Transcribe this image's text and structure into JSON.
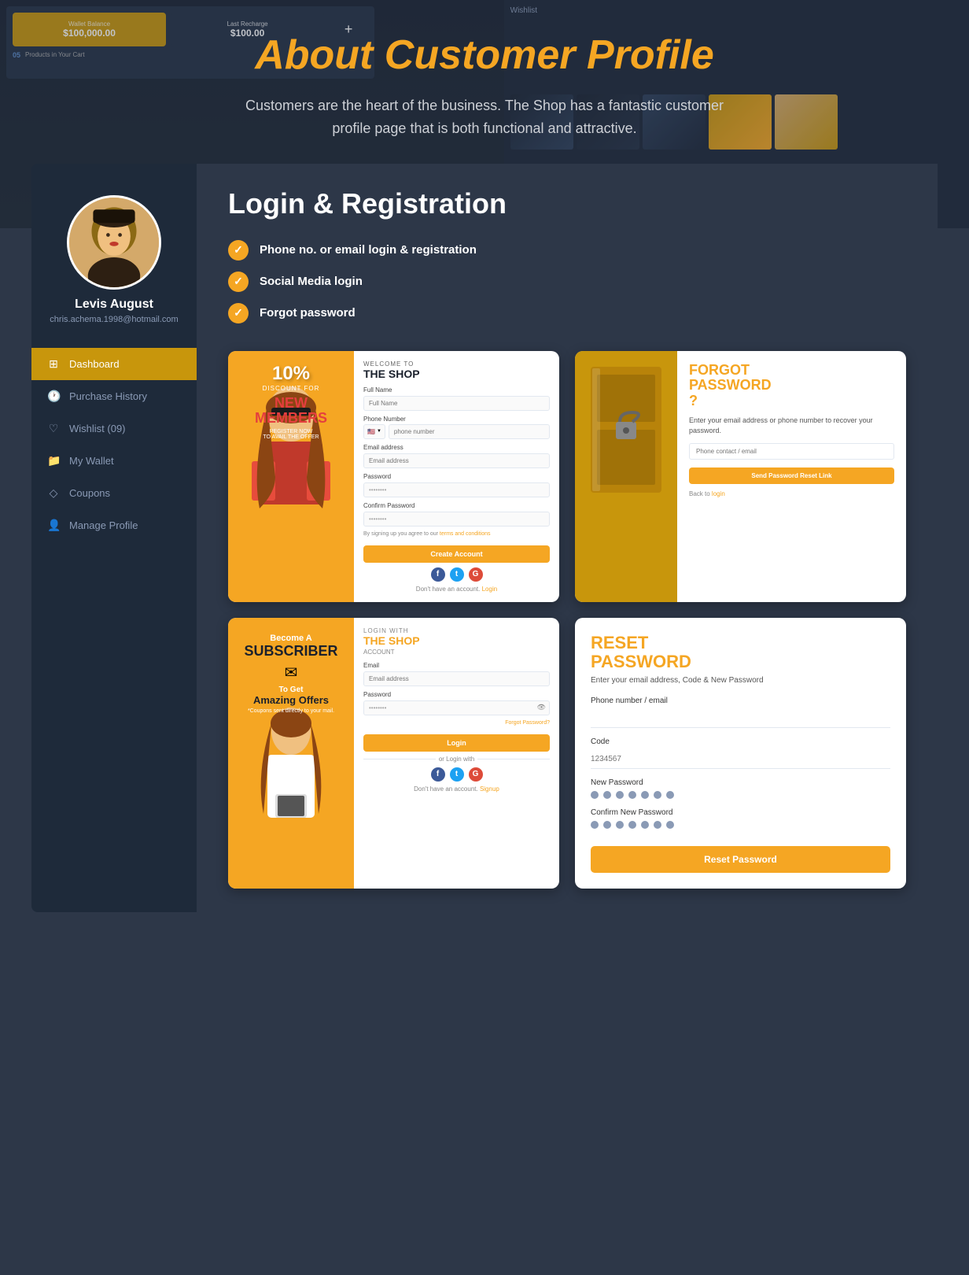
{
  "page": {
    "title": "About Customer Profile"
  },
  "about": {
    "title": "About Customer Profile",
    "description": "Customers are the heart of the business. The Shop has a fantastic customer profile page that is both functional and attractive."
  },
  "login_reg": {
    "heading": "Login & Registration",
    "features": [
      "Phone no. or email login & registration",
      "Social Media login",
      "Forgot password"
    ]
  },
  "sidebar": {
    "user_name": "Levis August",
    "user_email": "chris.achema.1998@hotmail.com",
    "menu_items": [
      {
        "label": "Dashboard",
        "active": true,
        "icon": "grid"
      },
      {
        "label": "Purchase History",
        "active": false,
        "icon": "clock"
      },
      {
        "label": "Wishlist (09)",
        "active": false,
        "icon": "heart"
      },
      {
        "label": "My Wallet",
        "active": false,
        "icon": "folder"
      },
      {
        "label": "Coupons",
        "active": false,
        "icon": "diamond"
      },
      {
        "label": "Manage Profile",
        "active": false,
        "icon": "person"
      }
    ]
  },
  "registration_card": {
    "welcome_label": "WELCOME TO",
    "shop_title": "THE SHOP",
    "discount": "10%",
    "discount_label": "DISCOUNT FOR",
    "new_members": "NEW\nMEMBERS",
    "register_now": "REGISTER NOW TO AVAIL THE OFFER",
    "fields": {
      "full_name_label": "Full Name",
      "full_name_placeholder": "Full Name",
      "phone_label": "Phone Number",
      "phone_placeholder": "phone number",
      "email_label": "Email address",
      "email_placeholder": "Email address",
      "password_label": "Password",
      "confirm_label": "Confirm Password"
    },
    "terms_text": "By signing up you agree to our terms and conditions",
    "create_btn": "Create Account",
    "no_account": "Don't have an account.",
    "login_link": "Login"
  },
  "forgot_card": {
    "title": "FORGOT\nPASSWORD\n?",
    "description": "Enter your email address or phone number to recover your password.",
    "placeholder": "Phone contact / email",
    "send_btn": "Send Password Reset Link",
    "back_text": "Back to",
    "login_link": "login"
  },
  "login_card": {
    "login_with": "LOGIN WITH",
    "shop_title": "THE SHOP",
    "account_label": "ACCOUNT",
    "email_label": "Email",
    "email_placeholder": "Email address",
    "password_label": "Password",
    "forgot_link": "Forgot Password?",
    "login_btn": "Login",
    "or_text": "or Login with",
    "no_account": "Don't have an account.",
    "signup_link": "Signup",
    "subscriber": {
      "become_a": "Become A",
      "subscriber": "SUBSCRIBER",
      "to_get": "To Get",
      "amazing_offers": "Amazing Offers",
      "coupon_text": "*Coupons sent directly to your mail."
    }
  },
  "reset_card": {
    "title": "RESET\nPASSWORD",
    "description": "Enter your email address, Code & New Password",
    "phone_label": "Phone number / email",
    "code_label": "Code",
    "code_placeholder": "1234567",
    "new_password_label": "New Password",
    "confirm_password_label": "Confirm New Password",
    "reset_btn": "Reset Password"
  },
  "colors": {
    "accent": "#f5a623",
    "dark_bg": "#2d3748",
    "sidebar_bg": "#1e2a3a",
    "card_bg": "#ffffff",
    "text_light": "#ffffff",
    "text_muted": "#8a9ab5",
    "red_text": "#e53e3e"
  }
}
